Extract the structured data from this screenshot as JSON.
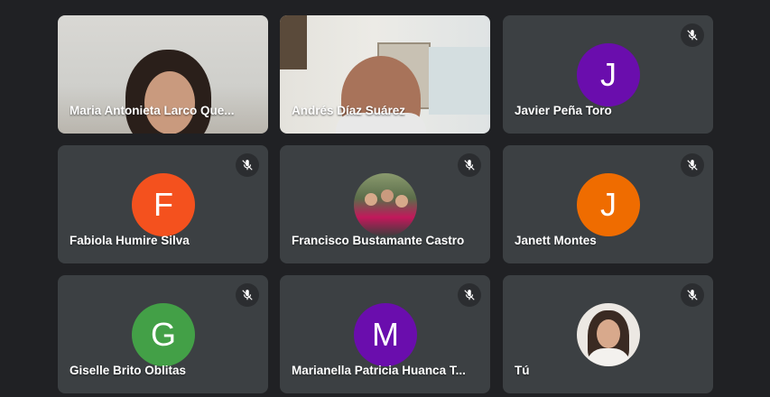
{
  "participants": [
    {
      "name": "Maria Antonieta Larco Que...",
      "type": "video"
    },
    {
      "name": "Andrés Díaz Suárez",
      "type": "video"
    },
    {
      "name": "Javier Peña Toro",
      "initial": "J",
      "color": "#6a0dad",
      "muted": true
    },
    {
      "name": "Fabiola Humire Silva",
      "initial": "F",
      "color": "#f4511e",
      "muted": true
    },
    {
      "name": "Francisco Bustamante Castro",
      "type": "photo",
      "muted": true
    },
    {
      "name": "Janett Montes",
      "initial": "J",
      "color": "#ef6c00",
      "muted": true
    },
    {
      "name": "Giselle Brito Oblitas",
      "initial": "G",
      "color": "#43a047",
      "muted": true
    },
    {
      "name": "Marianella Patricia Huanca T...",
      "initial": "M",
      "color": "#6a0dad",
      "muted": true
    },
    {
      "name": "Tú",
      "type": "photo",
      "muted": true
    }
  ],
  "icons": {
    "mute": "mic-off-icon"
  }
}
